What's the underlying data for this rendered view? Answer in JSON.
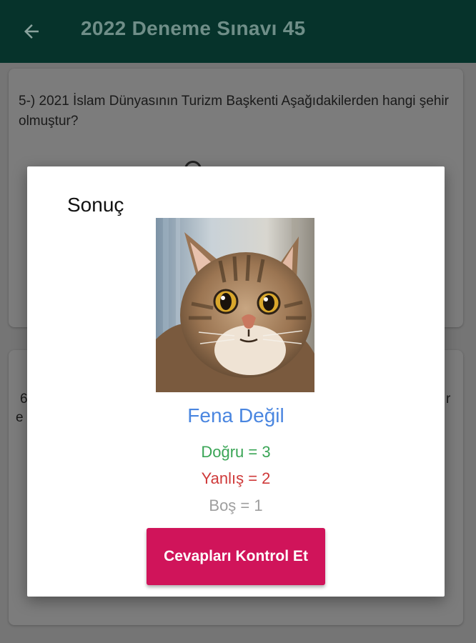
{
  "appbar": {
    "title": "2022 Deneme Sınavı 45",
    "back_icon": "arrow-left-icon"
  },
  "question5": {
    "text": "5-) 2021 İslam Dünyasının Turizm Başkenti Aşağıdakilerden hangi şehir olmuştur?"
  },
  "question6": {
    "fragment_left": "6",
    "fragment_left2": "e",
    "fragment_right": "r"
  },
  "dialog": {
    "title": "Sonuç",
    "image": "cat-photo",
    "verdict": "Fena Değil",
    "correct": "Doğru = 3",
    "wrong": "Yanlış = 2",
    "empty": "Boş = 1",
    "button_label": "Cevapları Kontrol Et"
  },
  "colors": {
    "appbar": "#06332b",
    "verdict": "#4a86e0",
    "correct": "#3aa556",
    "wrong": "#cf3a3a",
    "empty": "#9e9e9e",
    "button": "#d0145a"
  }
}
